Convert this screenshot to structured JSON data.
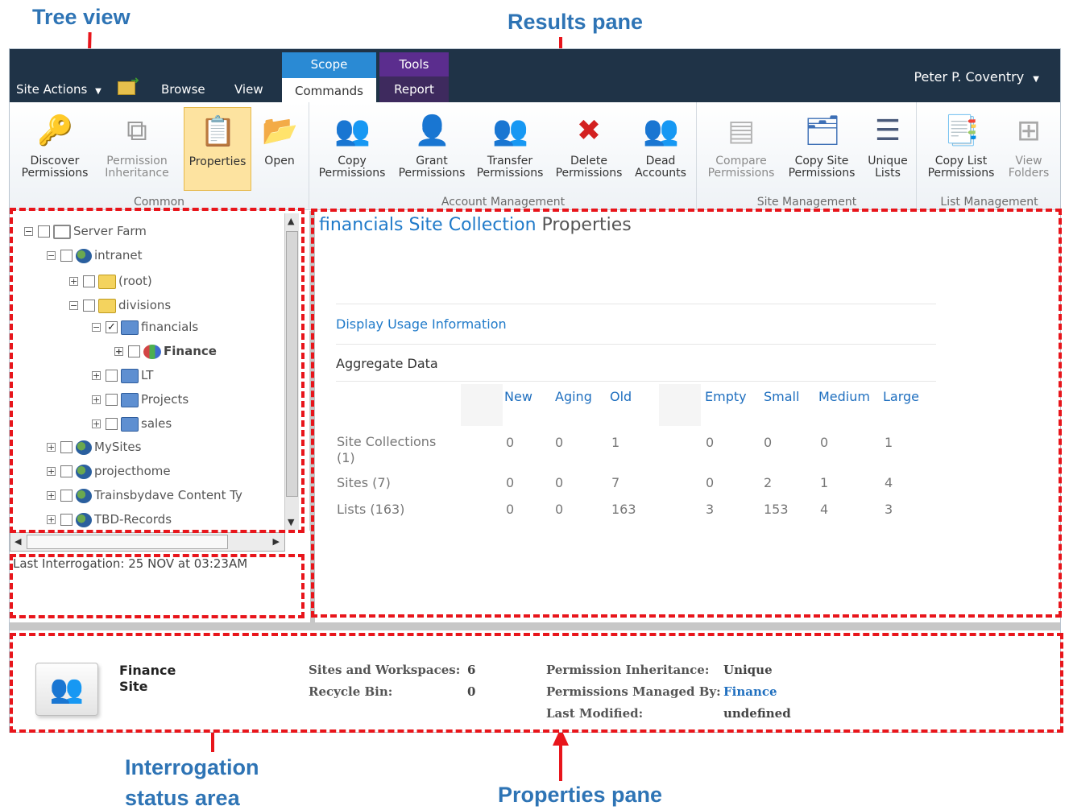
{
  "callouts": {
    "tree_view": "Tree view",
    "results_pane": "Results pane",
    "interrogation": [
      "Interrogation",
      "status area"
    ],
    "properties_pane": "Properties pane"
  },
  "topbar": {
    "contextual_tabs": {
      "scope": "Scope",
      "tools": "Tools"
    },
    "site_actions": "Site Actions",
    "tabs": {
      "browse": "Browse",
      "view": "View",
      "commands": "Commands",
      "report": "Report"
    },
    "user": "Peter P. Coventry"
  },
  "ribbon": {
    "groups": {
      "common": "Common",
      "account": "Account Management",
      "site": "Site Management",
      "list": "List Management"
    },
    "buttons": {
      "discover": [
        "Discover",
        "Permissions"
      ],
      "inheritance": [
        "Permission",
        "Inheritance"
      ],
      "properties": "Properties",
      "open": "Open",
      "copy_perm": [
        "Copy",
        "Permissions"
      ],
      "grant_perm": [
        "Grant",
        "Permissions"
      ],
      "transfer_perm": [
        "Transfer",
        "Permissions"
      ],
      "delete_perm": [
        "Delete",
        "Permissions"
      ],
      "dead_accounts": [
        "Dead",
        "Accounts"
      ],
      "compare_perm": [
        "Compare",
        "Permissions"
      ],
      "copy_site_perm": [
        "Copy Site",
        "Permissions"
      ],
      "unique_lists": [
        "Unique",
        "Lists"
      ],
      "copy_list_perm": [
        "Copy List",
        "Permissions"
      ],
      "view_folders": [
        "View",
        "Folders"
      ]
    }
  },
  "tree": {
    "nodes": [
      "Server Farm",
      "intranet",
      "(root)",
      "divisions",
      "financials",
      "Finance",
      "LT",
      "Projects",
      "sales",
      "MySites",
      "projecthome",
      "Trainsbydave Content Ty",
      "TBD-Records"
    ]
  },
  "interrogation_status": "Last Interrogation: 25 NOV at 03:23AM",
  "results": {
    "title_highlight": "financials Site Collection",
    "title_rest": "Properties",
    "usage_link": "Display Usage Information",
    "aggregate_title": "Aggregate Data",
    "columns": [
      "New",
      "Aging",
      "Old",
      "Empty",
      "Small",
      "Medium",
      "Large"
    ],
    "rows": [
      {
        "label": [
          "Site Collections",
          "(1)"
        ],
        "values": [
          "0",
          "0",
          "1",
          "0",
          "0",
          "0",
          "1"
        ]
      },
      {
        "label": [
          "Sites (7)"
        ],
        "values": [
          "0",
          "0",
          "7",
          "0",
          "2",
          "1",
          "4"
        ]
      },
      {
        "label": [
          "Lists (163)"
        ],
        "values": [
          "0",
          "0",
          "163",
          "3",
          "153",
          "4",
          "3"
        ]
      }
    ]
  },
  "properties": {
    "name": [
      "Finance",
      "Site"
    ],
    "sites_label": "Sites and Workspaces:",
    "sites_value": "6",
    "recycle_label": "Recycle Bin:",
    "recycle_value": "0",
    "inherit_label": "Permission Inheritance:",
    "inherit_value": "Unique",
    "managed_label": "Permissions Managed By:",
    "managed_value": "Finance",
    "modified_label": "Last Modified:",
    "modified_value": "undefined"
  }
}
